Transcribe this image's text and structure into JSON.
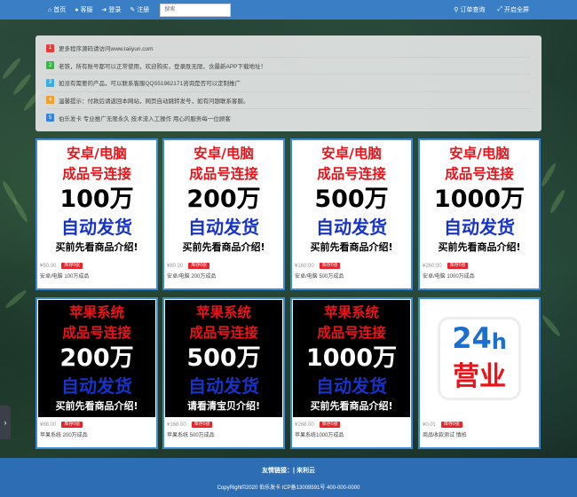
{
  "nav": {
    "home": "首页",
    "service": "客服",
    "login": "登录",
    "register": "注册",
    "search_placeholder": "搜索",
    "order_query": "订单查询",
    "fullscreen": "开启全屏"
  },
  "notices": [
    {
      "num": "1",
      "color": "#e53b3b",
      "text": "更多程序源码请访问www.laiiyun.com"
    },
    {
      "num": "2",
      "color": "#3bb54a",
      "text": "老铁，所有账号都可以正常使用，欢迎购买，登录既无限，含最新APP下载地址！"
    },
    {
      "num": "3",
      "color": "#3aaee0",
      "text": "如没有需要的产品，可以联系客服QQ551962171咨询是否可以定制推广"
    },
    {
      "num": "4",
      "color": "#f0a030",
      "text": "温馨提示：付款后请返回本网站，网页自动跳转发号，如有问题联系客服。"
    },
    {
      "num": "5",
      "color": "#3b7fd6",
      "text": "伯乐发卡 专业推广无限永久 技术流入工操作 用心的服务每一位顾客"
    }
  ],
  "products": [
    {
      "theme": "light",
      "l1": "安卓/电脑",
      "l2": "成品号连接",
      "l3": "100万",
      "l4": "自动发货",
      "l5": "买前先看商品介绍!",
      "price": "¥50.00",
      "stock": "库存0张",
      "name": "安卓/电脑 100万成品"
    },
    {
      "theme": "light",
      "l1": "安卓/电脑",
      "l2": "成品号连接",
      "l3": "200万",
      "l4": "自动发货",
      "l5": "买前先看商品介绍!",
      "price": "¥80.00",
      "stock": "库存0张",
      "name": "安卓/电脑 200万成品"
    },
    {
      "theme": "light",
      "l1": "安卓/电脑",
      "l2": "成品号连接",
      "l3": "500万",
      "l4": "自动发货",
      "l5": "买前先看商品介绍!",
      "price": "¥160.00",
      "stock": "库存0张",
      "name": "安卓/电脑 500万成品"
    },
    {
      "theme": "light",
      "l1": "安卓/电脑",
      "l2": "成品号连接",
      "l3": "1000万",
      "l4": "自动发货",
      "l5": "买前先看商品介绍!",
      "price": "¥260.00",
      "stock": "库存0张",
      "name": "安卓/电脑 1000万成品"
    },
    {
      "theme": "dark",
      "l1": "苹果系统",
      "l2": "成品号连接",
      "l3": "200万",
      "l4": "自动发货",
      "l5": "买前先看商品介绍!",
      "price": "¥88.00",
      "stock": "库存0张",
      "name": "苹果系统 200万成品"
    },
    {
      "theme": "dark",
      "l1": "苹果系统",
      "l2": "成品号连接",
      "l3": "500万",
      "l4": "自动发货",
      "l5": "请看清宝贝介绍!",
      "price": "¥168.00",
      "stock": "库存0张",
      "name": "苹果系统 500万成品"
    },
    {
      "theme": "dark",
      "l1": "苹果系统",
      "l2": "成品号连接",
      "l3": "1000万",
      "l4": "自动发货",
      "l5": "买前先看商品介绍!",
      "price": "¥268.00",
      "stock": "库存0张",
      "name": "苹果系统1000万成品"
    },
    {
      "theme": "clock",
      "c1": "24",
      "c2": "h",
      "c3": "营业",
      "price": "¥0.01",
      "stock": "库存0张",
      "name": "商品收款测试 慎拍"
    }
  ],
  "footer": {
    "links": "友情链接：| 来利云",
    "copyright": "CopyRight©2020 伯乐发卡   ICP备13009591号   400-000-0000"
  }
}
